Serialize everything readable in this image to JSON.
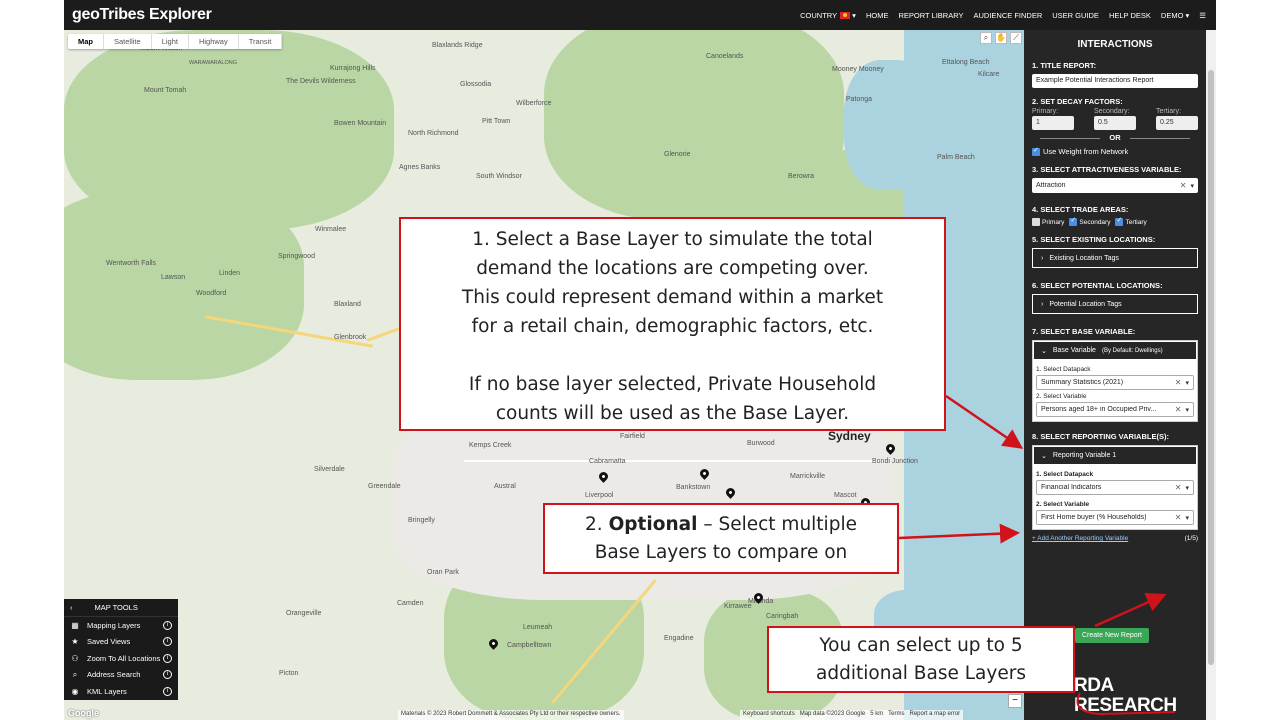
{
  "app": {
    "title": "geoTribes Explorer",
    "nav": [
      "COUNTRY",
      "HOME",
      "REPORT LIBRARY",
      "AUDIENCE FINDER",
      "USER GUIDE",
      "HELP DESK",
      "DEMO"
    ]
  },
  "map": {
    "tabs": [
      "Map",
      "Satellite",
      "Light",
      "Highway",
      "Transit"
    ],
    "labels": [
      "Mount Wilson",
      "WARAWARALONG",
      "Mount Tomah",
      "The Devils Wilderness",
      "Kurrajong Hills",
      "Blaxlands Ridge",
      "Glossodia",
      "Pitt Town",
      "Wilberforce",
      "Canoelands",
      "Bowen Mountain",
      "North Richmond",
      "Agnes Banks",
      "South Windsor",
      "Glenorie",
      "Mooney Mooney",
      "Ettalong Beach",
      "Kilcare",
      "Patonga",
      "Palm Beach",
      "Berowra",
      "Winmalee",
      "Springwood",
      "Wentworth Falls",
      "Lawson",
      "Linden",
      "Woodford",
      "Blaxland",
      "Glenbrook",
      "Kemps Creek",
      "Fairfield",
      "Burwood",
      "Sydney",
      "Bondi Junction",
      "Cabramatta",
      "Bankstown",
      "Marrickville",
      "Liverpool",
      "Mascot",
      "Silverdale",
      "Greendale",
      "Austral",
      "Bringelly",
      "Oran Park",
      "Camden",
      "Orangeville",
      "Picton",
      "Leumeah",
      "Campbelltown",
      "Engadine",
      "Miranda",
      "Caringbah",
      "Kirrawee"
    ],
    "city": "Sydney",
    "attribution": "Materials © 2023 Robert Dommett & Associates Pty Ltd or their respective owners.",
    "footer": [
      "Keyboard shortcuts",
      "Map data ©2023 Google",
      "5 km",
      "Terms",
      "Report a map error"
    ],
    "google": "Google"
  },
  "tools": {
    "title": "MAP TOOLS",
    "items": [
      "Mapping Layers",
      "Saved Views",
      "Zoom To All Locations",
      "Address Search",
      "KML Layers"
    ]
  },
  "panel": {
    "title": "INTERACTIONS",
    "s1": "1. TITLE REPORT:",
    "report_title": "Example Potential Interactions Report",
    "s2": "2. SET DECAY FACTORS:",
    "decay": [
      {
        "label": "Primary:",
        "value": "1"
      },
      {
        "label": "Secondary:",
        "value": "0.5"
      },
      {
        "label": "Tertiary:",
        "value": "0.25"
      }
    ],
    "or": "OR",
    "use_weight": "Use Weight from Network",
    "s3": "3. SELECT ATTRACTIVENESS VARIABLE:",
    "attraction": "Attraction",
    "s4": "4. SELECT TRADE AREAS:",
    "trade": [
      "Primary",
      "Secondary",
      "Tertiary"
    ],
    "s5": "5. SELECT EXISTING LOCATIONS:",
    "existing": "Existing Location Tags",
    "s6": "6. SELECT POTENTIAL LOCATIONS:",
    "potential": "Potential Location Tags",
    "s7": "7. SELECT BASE VARIABLE:",
    "base_head": "Base Variable",
    "base_head_note": "(By Default: Dwellings)",
    "select_datapack": "1. Select Datapack",
    "base_datapack": "Summary Statistics (2021)",
    "select_variable": "2. Select Variable",
    "base_variable": "Persons aged 18+ in Occupied Priv...",
    "s8": "8. SELECT REPORTING VARIABLE(S):",
    "rep_head": "Reporting Variable 1",
    "rep_datapack": "Financial Indicators",
    "rep_variable": "First Home buyer (% Households)",
    "add_link": "+ Add Another Reporting Variable",
    "count": "(1/5)",
    "create": "Create New Report",
    "logo": [
      "RDA",
      "RESEARCH"
    ]
  },
  "callouts": {
    "c1": [
      "1. Select a Base Layer to simulate the total",
      "demand the locations are competing over.",
      "This could represent demand within a market",
      "for a retail chain, demographic factors, etc.",
      "",
      "If no base layer selected, Private Household",
      "counts will be used as the Base Layer."
    ],
    "c2_bold": "Optional",
    "c2_prefix": "2. ",
    "c2_rest": " – Select multiple",
    "c2_line2": "Base Layers to compare on",
    "c3": [
      "You can select up to 5",
      "additional Base Layers"
    ]
  },
  "colors": {
    "accent_red": "#d0121b",
    "panel_bg": "#262626",
    "create_button": "#3aa757",
    "water": "#aad3df",
    "park": "#b9d6a4"
  }
}
